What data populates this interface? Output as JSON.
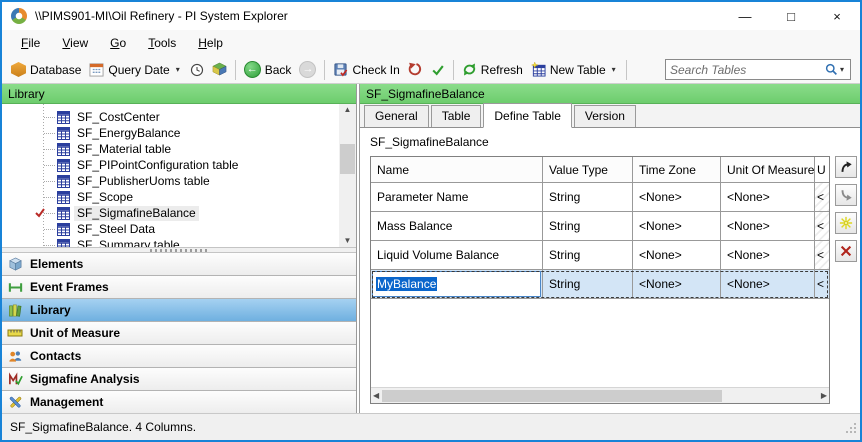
{
  "window": {
    "title": "\\\\PIMS901-MI\\Oil Refinery - PI System Explorer",
    "controls": {
      "minimize": "—",
      "maximize": "□",
      "close": "×"
    }
  },
  "icons": {
    "caret_down": "▾",
    "scroll_up": "▲",
    "scroll_down": "▼",
    "scroll_left": "◀",
    "scroll_right": "▶",
    "back_arrow": "←",
    "forward_arrow": "→"
  },
  "menu": {
    "items": [
      "File",
      "View",
      "Go",
      "Tools",
      "Help"
    ]
  },
  "toolbar": {
    "database_label": "Database",
    "query_date_label": "Query Date",
    "back_label": "Back",
    "check_in_label": "Check In",
    "refresh_label": "Refresh",
    "new_table_label": "New Table",
    "search_placeholder": "Search Tables"
  },
  "left_panel": {
    "header": "Library",
    "tree_items": [
      {
        "label": "SF_CostCenter"
      },
      {
        "label": "SF_EnergyBalance"
      },
      {
        "label": "SF_Material table"
      },
      {
        "label": "SF_PIPointConfiguration table"
      },
      {
        "label": "SF_PublisherUoms table"
      },
      {
        "label": "SF_Scope"
      },
      {
        "label": "SF_SigmafineBalance",
        "selected": true,
        "checked_out": true
      },
      {
        "label": "SF_Steel Data"
      },
      {
        "label": "SF_Summary table"
      }
    ],
    "nav_items": [
      {
        "label": "Elements"
      },
      {
        "label": "Event Frames"
      },
      {
        "label": "Library",
        "selected": true
      },
      {
        "label": "Unit of Measure"
      },
      {
        "label": "Contacts"
      },
      {
        "label": "Sigmafine Analysis"
      },
      {
        "label": "Management"
      }
    ]
  },
  "right_panel": {
    "header": "SF_SigmafineBalance",
    "tabs": [
      {
        "label": "General"
      },
      {
        "label": "Table"
      },
      {
        "label": "Define Table",
        "active": true
      },
      {
        "label": "Version"
      }
    ],
    "table_name": "SF_SigmafineBalance",
    "grid": {
      "columns": [
        "Name",
        "Value Type",
        "Time Zone",
        "Unit Of Measure",
        "U"
      ],
      "rows": [
        {
          "name": "Parameter Name",
          "value_type": "String",
          "time_zone": "<None>",
          "uom": "<None>",
          "u": "<"
        },
        {
          "name": "Mass Balance",
          "value_type": "String",
          "time_zone": "<None>",
          "uom": "<None>",
          "u": "<"
        },
        {
          "name": "Liquid Volume Balance",
          "value_type": "String",
          "time_zone": "<None>",
          "uom": "<None>",
          "u": "<"
        },
        {
          "name": "MyBalance",
          "value_type": "String",
          "time_zone": "<None>",
          "uom": "<None>",
          "u": "<",
          "editing": true
        }
      ]
    }
  },
  "status_bar": {
    "text": "SF_SigmafineBalance. 4 Columns."
  },
  "colors": {
    "header_green": "#7bd47b",
    "nav_selected_blue": "#7db9e8",
    "edit_selection_blue": "#0a66cc",
    "window_border_blue": "#1883d7",
    "checked_out_red": "#b92b27"
  }
}
